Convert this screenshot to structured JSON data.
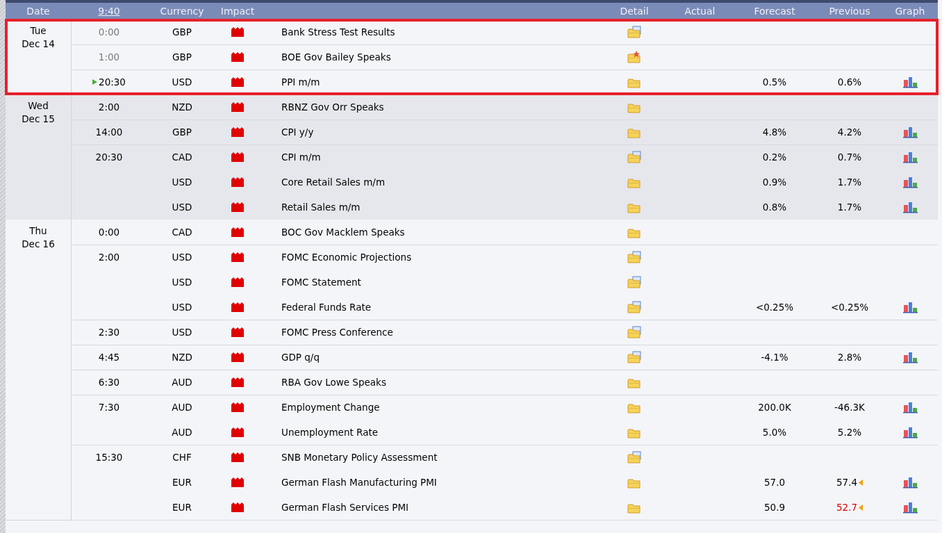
{
  "header": {
    "columns": [
      "Date",
      "9:40",
      "Currency",
      "Impact",
      "Detail",
      "Actual",
      "Forecast",
      "Previous",
      "Graph"
    ]
  },
  "days": [
    {
      "weekday": "Tue",
      "date": "Dec 14",
      "shaded": false,
      "highlighted": true,
      "groups": [
        {
          "time": "0:00",
          "past": true,
          "next": false,
          "events": [
            {
              "currency": "GBP",
              "title": "Bank Stress Test Results",
              "kind": "folder-doc",
              "revised": false,
              "graph": false
            }
          ]
        },
        {
          "time": "1:00",
          "past": true,
          "next": false,
          "events": [
            {
              "currency": "GBP",
              "title": "BOE Gov Bailey Speaks",
              "kind": "folder-star",
              "revised": false,
              "graph": false
            }
          ]
        },
        {
          "time": "20:30",
          "past": false,
          "next": true,
          "events": [
            {
              "currency": "USD",
              "title": "PPI m/m",
              "kind": "folder",
              "forecast": "0.5%",
              "previous": "0.6%",
              "worse": false,
              "revised": false,
              "graph": true
            }
          ]
        }
      ]
    },
    {
      "weekday": "Wed",
      "date": "Dec 15",
      "shaded": true,
      "highlighted": false,
      "groups": [
        {
          "time": "2:00",
          "past": false,
          "next": false,
          "events": [
            {
              "currency": "NZD",
              "title": "RBNZ Gov Orr Speaks",
              "kind": "folder",
              "revised": false,
              "graph": false
            }
          ]
        },
        {
          "time": "14:00",
          "past": false,
          "next": false,
          "events": [
            {
              "currency": "GBP",
              "title": "CPI y/y",
              "kind": "folder",
              "forecast": "4.8%",
              "previous": "4.2%",
              "worse": false,
              "revised": false,
              "graph": true
            }
          ]
        },
        {
          "time": "20:30",
          "past": false,
          "next": false,
          "events": [
            {
              "currency": "CAD",
              "title": "CPI m/m",
              "kind": "folder-doc",
              "forecast": "0.2%",
              "previous": "0.7%",
              "worse": false,
              "revised": false,
              "graph": true
            },
            {
              "currency": "USD",
              "title": "Core Retail Sales m/m",
              "kind": "folder",
              "forecast": "0.9%",
              "previous": "1.7%",
              "worse": false,
              "revised": false,
              "graph": true
            },
            {
              "currency": "USD",
              "title": "Retail Sales m/m",
              "kind": "folder",
              "forecast": "0.8%",
              "previous": "1.7%",
              "worse": false,
              "revised": false,
              "graph": true
            }
          ]
        }
      ]
    },
    {
      "weekday": "Thu",
      "date": "Dec 16",
      "shaded": false,
      "highlighted": false,
      "groups": [
        {
          "time": "0:00",
          "past": false,
          "next": false,
          "events": [
            {
              "currency": "CAD",
              "title": "BOC Gov Macklem Speaks",
              "kind": "folder",
              "revised": false,
              "graph": false
            }
          ]
        },
        {
          "time": "2:00",
          "past": false,
          "next": false,
          "events": [
            {
              "currency": "USD",
              "title": "FOMC Economic Projections",
              "kind": "folder-doc",
              "revised": false,
              "graph": false
            },
            {
              "currency": "USD",
              "title": "FOMC Statement",
              "kind": "folder-doc",
              "revised": false,
              "graph": false
            },
            {
              "currency": "USD",
              "title": "Federal Funds Rate",
              "kind": "folder-doc",
              "forecast": "<0.25%",
              "previous": "<0.25%",
              "worse": false,
              "revised": false,
              "graph": true
            }
          ]
        },
        {
          "time": "2:30",
          "past": false,
          "next": false,
          "events": [
            {
              "currency": "USD",
              "title": "FOMC Press Conference",
              "kind": "folder-doc",
              "revised": false,
              "graph": false
            }
          ]
        },
        {
          "time": "4:45",
          "past": false,
          "next": false,
          "events": [
            {
              "currency": "NZD",
              "title": "GDP q/q",
              "kind": "folder-doc",
              "forecast": "-4.1%",
              "previous": "2.8%",
              "worse": false,
              "revised": false,
              "graph": true
            }
          ]
        },
        {
          "time": "6:30",
          "past": false,
          "next": false,
          "events": [
            {
              "currency": "AUD",
              "title": "RBA Gov Lowe Speaks",
              "kind": "folder",
              "revised": false,
              "graph": false
            }
          ]
        },
        {
          "time": "7:30",
          "past": false,
          "next": false,
          "events": [
            {
              "currency": "AUD",
              "title": "Employment Change",
              "kind": "folder",
              "forecast": "200.0K",
              "previous": "-46.3K",
              "worse": false,
              "revised": false,
              "graph": true
            },
            {
              "currency": "AUD",
              "title": "Unemployment Rate",
              "kind": "folder",
              "forecast": "5.0%",
              "previous": "5.2%",
              "worse": false,
              "revised": false,
              "graph": true
            }
          ]
        },
        {
          "time": "15:30",
          "past": false,
          "next": false,
          "events": [
            {
              "currency": "CHF",
              "title": "SNB Monetary Policy Assessment",
              "kind": "folder-doc",
              "revised": false,
              "graph": false
            },
            {
              "currency": "EUR",
              "title": "German Flash Manufacturing PMI",
              "kind": "folder",
              "forecast": "57.0",
              "previous": "57.4",
              "worse": false,
              "revised": true,
              "graph": true
            },
            {
              "currency": "EUR",
              "title": "German Flash Services PMI",
              "kind": "folder",
              "forecast": "50.9",
              "previous": "52.7",
              "worse": true,
              "revised": true,
              "graph": true
            }
          ]
        }
      ]
    }
  ]
}
